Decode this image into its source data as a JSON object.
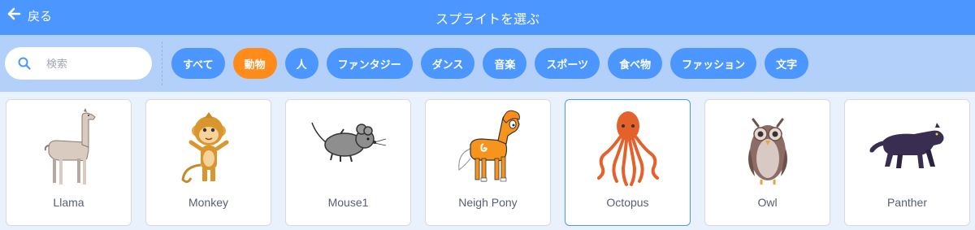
{
  "header": {
    "back_label": "戻る",
    "title": "スプライトを選ぶ"
  },
  "search": {
    "placeholder": "検索"
  },
  "tags": [
    {
      "label": "すべて",
      "active": false
    },
    {
      "label": "動物",
      "active": true
    },
    {
      "label": "人",
      "active": false
    },
    {
      "label": "ファンタジー",
      "active": false
    },
    {
      "label": "ダンス",
      "active": false
    },
    {
      "label": "音楽",
      "active": false
    },
    {
      "label": "スポーツ",
      "active": false
    },
    {
      "label": "食べ物",
      "active": false
    },
    {
      "label": "ファッション",
      "active": false
    },
    {
      "label": "文字",
      "active": false
    }
  ],
  "sprites": [
    {
      "name": "Llama",
      "icon": "llama-icon"
    },
    {
      "name": "Monkey",
      "icon": "monkey-icon"
    },
    {
      "name": "Mouse1",
      "icon": "mouse-icon"
    },
    {
      "name": "Neigh Pony",
      "icon": "pony-icon"
    },
    {
      "name": "Octopus",
      "icon": "octopus-icon",
      "selected": true
    },
    {
      "name": "Owl",
      "icon": "owl-icon"
    },
    {
      "name": "Panther",
      "icon": "panther-icon"
    }
  ],
  "colors": {
    "header": "#4c97ff",
    "active_tag": "#ff8c1a",
    "filter_bg": "#b3d0fb",
    "page_bg": "#e9f1fc"
  }
}
